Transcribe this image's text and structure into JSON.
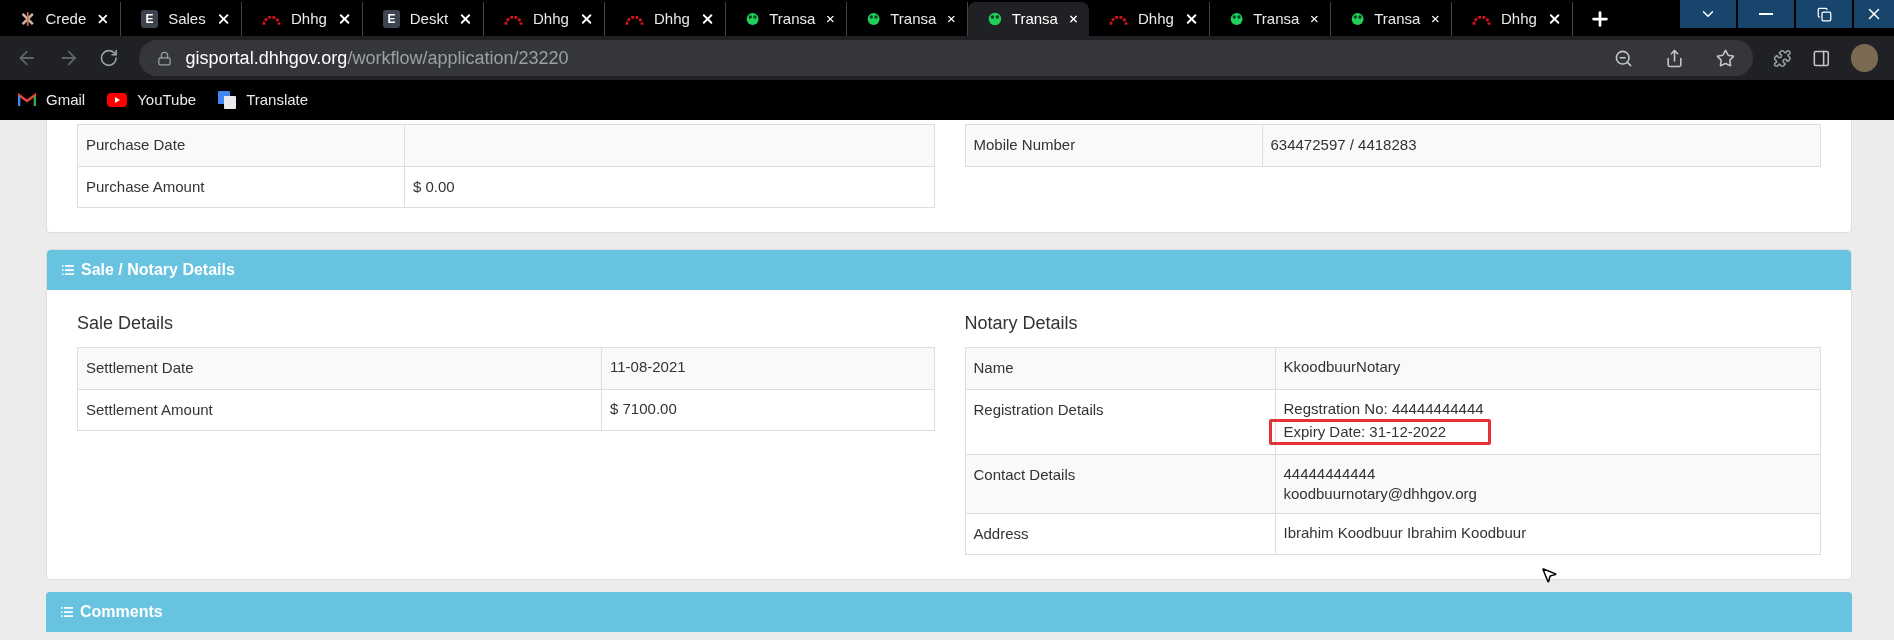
{
  "browser": {
    "tabs": [
      {
        "title": "Crede",
        "kind": "pinwheel",
        "selected": false
      },
      {
        "title": "Sales",
        "kind": "letter",
        "letter": "E",
        "selected": false
      },
      {
        "title": "Dhhg",
        "kind": "gauge",
        "selected": false
      },
      {
        "title": "Deskt",
        "kind": "letter",
        "letter": "E",
        "selected": false
      },
      {
        "title": "Dhhg",
        "kind": "gauge",
        "selected": false
      },
      {
        "title": "Dhhg",
        "kind": "gauge",
        "selected": false
      },
      {
        "title": "Transa",
        "kind": "frog",
        "selected": false
      },
      {
        "title": "Transa",
        "kind": "frog",
        "selected": false
      },
      {
        "title": "Transa",
        "kind": "frog",
        "selected": true
      },
      {
        "title": "Dhhg",
        "kind": "gauge",
        "selected": false
      },
      {
        "title": "Transa",
        "kind": "frog",
        "selected": false
      },
      {
        "title": "Transa",
        "kind": "frog",
        "selected": false
      },
      {
        "title": "Dhhg",
        "kind": "gauge",
        "selected": false
      }
    ],
    "url": {
      "host": "gisportal.dhhgov.org",
      "path": "/workflow/application/23220"
    },
    "bookmarks": [
      {
        "label": "Gmail",
        "kind": "gmail"
      },
      {
        "label": "YouTube",
        "kind": "youtube"
      },
      {
        "label": "Translate",
        "kind": "translate"
      }
    ]
  },
  "purchase_table": [
    {
      "label": "Purchase Date"
    },
    {
      "label": "Purchase Amount",
      "value": "$ 0.00"
    }
  ],
  "owner_table": [
    {
      "label": "Mobile Number",
      "value": "634472597 / 4418283"
    }
  ],
  "sale_notary": {
    "title": "Sale / Notary Details",
    "sale_details": {
      "title": "Sale Details",
      "rows": [
        {
          "label": "Settlement Date",
          "lines": [
            {
              "text": "11-08-2021",
              "highlighted": false
            }
          ]
        },
        {
          "label": "Settlement Amount",
          "lines": [
            {
              "text": "$ 7100.00",
              "highlighted": false
            }
          ]
        }
      ]
    },
    "notary_details": {
      "title": "Notary Details",
      "rows": [
        {
          "label": "Name",
          "lines": [
            {
              "text": "KkoodbuurNotary",
              "highlighted": false
            }
          ]
        },
        {
          "label": "Registration Details",
          "lines": [
            {
              "text": "Regstration No: 44444444444",
              "highlighted": false
            },
            {
              "text": "Expiry Date: 31-12-2022",
              "highlighted": true
            }
          ]
        },
        {
          "label": "Contact Details",
          "lines": [
            {
              "text": "44444444444",
              "highlighted": false
            },
            {
              "text": "koodbuurnotary@dhhgov.org",
              "highlighted": false
            }
          ]
        },
        {
          "label": "Address",
          "lines": [
            {
              "text": "Ibrahim Koodbuur Ibrahim Koodbuur",
              "highlighted": false
            }
          ]
        }
      ]
    }
  },
  "comments": {
    "title": "Comments"
  }
}
